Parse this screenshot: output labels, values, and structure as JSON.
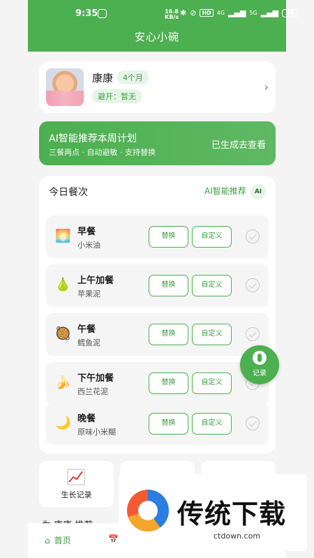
{
  "status_bar": {
    "time": "9:35",
    "speed_value": "16.8",
    "speed_unit": "KB/s",
    "hd": "HD",
    "net1": "4G",
    "net2": "5G",
    "battery": "36"
  },
  "header": {
    "title": "安心小碗"
  },
  "profile": {
    "name": "康康",
    "age": "4个月",
    "allergy": "避开：暂无",
    "chevron": "›"
  },
  "ai_banner": {
    "title": "AI智能推荐本周计划",
    "subtitle": "三餐两点 · 自动避敏 · 支持替换",
    "cta": "已生成去查看"
  },
  "today": {
    "title": "今日餐次",
    "ai_label": "AI智能推荐",
    "ai_chip": "AI",
    "meals": [
      {
        "name": "早餐",
        "food": "小米油",
        "icon": "sunrise-icon",
        "glyph": "🌅",
        "swap": "替换",
        "custom": "自定义",
        "done": false
      },
      {
        "name": "上午加餐",
        "food": "苹果泥",
        "icon": "pear-icon",
        "glyph": "🍐",
        "swap": "替换",
        "custom": "自定义",
        "done": false
      },
      {
        "name": "午餐",
        "food": "鳕鱼泥",
        "icon": "pot-icon",
        "glyph": "🥘",
        "swap": "替换",
        "custom": "自定义",
        "done": false
      },
      {
        "name": "下午加餐",
        "food": "西兰花泥",
        "icon": "banana-icon",
        "glyph": "🍌",
        "swap": "替换",
        "custom": "自定义",
        "done": false
      },
      {
        "name": "晚餐",
        "food": "原味小米糊",
        "icon": "moon-icon",
        "glyph": "🌙",
        "swap": "替换",
        "custom": "自定义",
        "done": false
      }
    ]
  },
  "fab": {
    "label": "记录",
    "icon": "plate-icon"
  },
  "tiles": [
    {
      "label": "生长记录",
      "icon": "growth-chart-icon"
    }
  ],
  "peek": {
    "text": "为 康康 推荐"
  },
  "bottom_nav": {
    "home": "首页",
    "home_icon": "home-icon",
    "plan_icon": "calendar-icon",
    "plan_glyph": "📅"
  },
  "watermark": {
    "text": "传统下载",
    "url": "ctdown.com"
  },
  "colors": {
    "primary": "#4caf50",
    "primary_dark": "#3e9c43",
    "badge_bg": "#e7f4e8",
    "page_bg": "#f3f4f3"
  }
}
